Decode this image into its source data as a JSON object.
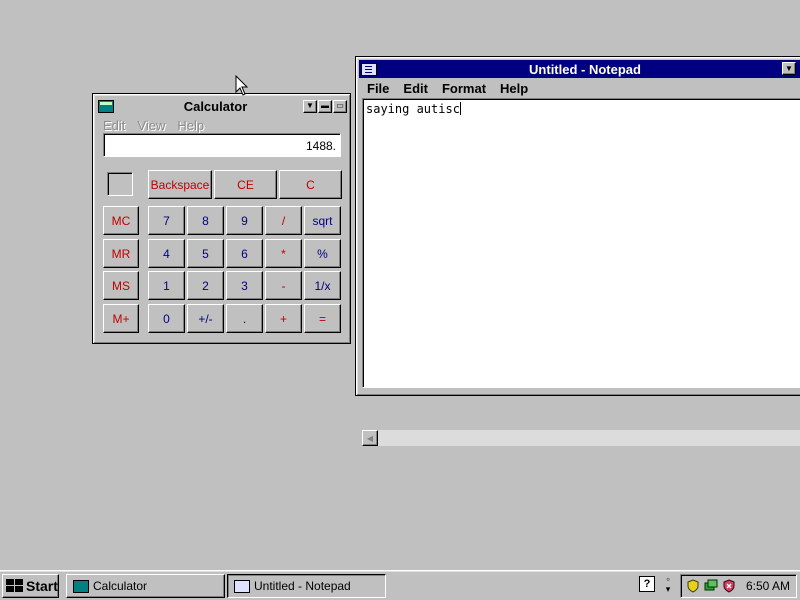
{
  "calculator": {
    "title": "Calculator",
    "menu": [
      "Edit",
      "View",
      "Help"
    ],
    "display": "1488.",
    "buttons": {
      "backspace": "Backspace",
      "ce": "CE",
      "c": "C",
      "mc": "MC",
      "mr": "MR",
      "ms": "MS",
      "mplus": "M+",
      "seven": "7",
      "eight": "8",
      "nine": "9",
      "divide": "/",
      "sqrt": "sqrt",
      "four": "4",
      "five": "5",
      "six": "6",
      "multiply": "*",
      "percent": "%",
      "one": "1",
      "two": "2",
      "three": "3",
      "minus": "-",
      "reciprocal": "1/x",
      "zero": "0",
      "plusminus": "+/-",
      "decimal": ".",
      "plus": "+",
      "equals": "="
    },
    "colors": {
      "memory_ops": "#c00000",
      "digits": "#000080"
    }
  },
  "notepad": {
    "title": "Untitled - Notepad",
    "menu": [
      "File",
      "Edit",
      "Format",
      "Help"
    ],
    "text": "saying autisc",
    "titlebar_color": "#000080"
  },
  "taskbar": {
    "start_label": "Start",
    "tasks": [
      {
        "label": "Calculator",
        "active": false
      },
      {
        "label": "Untitled - Notepad",
        "active": true
      }
    ],
    "clock": "6:50 AM",
    "help_glyph": "?"
  },
  "desktop": {
    "background": "#c0c0c0"
  }
}
